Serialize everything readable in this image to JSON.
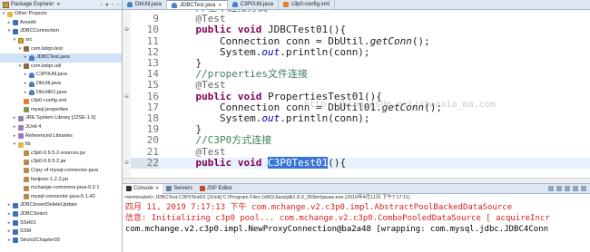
{
  "explorer": {
    "title": "Package Explorer",
    "close": "✕",
    "tools": "▫ ▾ ▫ ▫",
    "items": [
      {
        "twisty": "▾",
        "icon": "folder-icon",
        "label": "Other Projects",
        "indent": 0
      },
      {
        "twisty": "▸",
        "icon": "project-icon",
        "label": "Annoth",
        "indent": 1
      },
      {
        "twisty": "▾",
        "icon": "project-icon",
        "label": "JDBCConnection",
        "indent": 1
      },
      {
        "twisty": "▾",
        "icon": "source-folder-icon",
        "label": "src",
        "indent": 2
      },
      {
        "twisty": "▾",
        "icon": "package-icon",
        "label": "com.bdqn.test",
        "indent": 3
      },
      {
        "twisty": "▸",
        "icon": "java-file-icon",
        "label": "JDBCTest.java",
        "indent": 4,
        "selected": true
      },
      {
        "twisty": "▾",
        "icon": "package-icon",
        "label": "com.bdqn.util",
        "indent": 3
      },
      {
        "twisty": "▸",
        "icon": "java-file-icon",
        "label": "C3P0Util.java",
        "indent": 4
      },
      {
        "twisty": "▸",
        "icon": "java-file-icon",
        "label": "DbUtil.java",
        "indent": 4
      },
      {
        "twisty": "▸",
        "icon": "java-file-icon",
        "label": "DbUtil01.java",
        "indent": 4
      },
      {
        "twisty": "",
        "icon": "xml-file-icon",
        "label": "c3p0-config.xml",
        "indent": 3
      },
      {
        "twisty": "",
        "icon": "properties-file-icon",
        "label": "mysql.properties",
        "indent": 3
      },
      {
        "twisty": "▸",
        "icon": "library-icon",
        "label": "JRE System Library [J2SE-1.5]",
        "indent": 2
      },
      {
        "twisty": "▸",
        "icon": "library-icon",
        "label": "JUnit 4",
        "indent": 2
      },
      {
        "twisty": "▸",
        "icon": "library-icon",
        "label": "Referenced Libraries",
        "indent": 2
      },
      {
        "twisty": "▾",
        "icon": "folder-icon",
        "label": "lib",
        "indent": 2
      },
      {
        "twisty": "",
        "icon": "jar-icon",
        "label": "c3p0-0.9.5.2-sources.jar",
        "indent": 3
      },
      {
        "twisty": "",
        "icon": "jar-icon",
        "label": "c3p0-0.9.5.2.jar",
        "indent": 3
      },
      {
        "twisty": "",
        "icon": "jar-icon",
        "label": "Copy of mysql-connector-java",
        "indent": 3
      },
      {
        "twisty": "",
        "icon": "jar-icon",
        "label": "fastjson-1.2.2.jar",
        "indent": 3
      },
      {
        "twisty": "",
        "icon": "jar-icon",
        "label": "mchange-commons-java-0.2.1",
        "indent": 3
      },
      {
        "twisty": "",
        "icon": "jar-icon",
        "label": "mysql-connector-java-5.1.42-",
        "indent": 3
      },
      {
        "twisty": "▸",
        "icon": "project-icon",
        "label": "JDBCInsertDeleteUpdate",
        "indent": 1
      },
      {
        "twisty": "▸",
        "icon": "project-icon",
        "label": "JDBCSelect",
        "indent": 1
      },
      {
        "twisty": "▸",
        "icon": "project-icon",
        "label": "SSH01",
        "indent": 1
      },
      {
        "twisty": "▸",
        "icon": "project-icon",
        "label": "SSM",
        "indent": 1
      },
      {
        "twisty": "▸",
        "icon": "project-icon",
        "label": "Struts2Chapter03",
        "indent": 1
      }
    ]
  },
  "editor": {
    "tabs": [
      {
        "label": "DbUtil.java",
        "type": "java",
        "active": false
      },
      {
        "label": "JDBCTest.java",
        "type": "java",
        "active": true
      },
      {
        "label": "C3P0Util.java",
        "type": "java",
        "active": false
      },
      {
        "label": "c3p0-config.xml",
        "type": "xml",
        "active": false
      }
    ],
    "close": "✕",
    "watermark": "http://blog.csdn.net/zhaoxia_ma.com",
    "lines": [
      {
        "num": "",
        "indent": "    ",
        "parts": [
          {
            "c": "comment",
            "t": "//基本连接方式"
          }
        ]
      },
      {
        "num": "9",
        "indent": "    ",
        "parts": [
          {
            "c": "annotation",
            "t": "@Test"
          }
        ]
      },
      {
        "num": "10",
        "indent": "    ",
        "parts": [
          {
            "c": "keyword",
            "t": "public"
          },
          {
            "c": "",
            "t": " "
          },
          {
            "c": "keyword",
            "t": "void"
          },
          {
            "c": "",
            "t": " JDBCTest01(){"
          }
        ]
      },
      {
        "num": "11",
        "indent": "        ",
        "parts": [
          {
            "c": "",
            "t": "Connection conn = DbUtil."
          },
          {
            "c": "method",
            "t": "getConn"
          },
          {
            "c": "",
            "t": "();"
          }
        ]
      },
      {
        "num": "12",
        "indent": "        ",
        "parts": [
          {
            "c": "",
            "t": "System."
          },
          {
            "c": "field",
            "t": "out"
          },
          {
            "c": "",
            "t": ".println(conn);"
          }
        ]
      },
      {
        "num": "13",
        "indent": "    ",
        "parts": [
          {
            "c": "",
            "t": "}"
          }
        ]
      },
      {
        "num": "14",
        "indent": "    ",
        "parts": [
          {
            "c": "comment",
            "t": "//properties文件连接"
          }
        ]
      },
      {
        "num": "15",
        "indent": "    ",
        "parts": [
          {
            "c": "annotation",
            "t": "@Test"
          }
        ]
      },
      {
        "num": "16",
        "indent": "    ",
        "parts": [
          {
            "c": "keyword",
            "t": "public"
          },
          {
            "c": "",
            "t": " "
          },
          {
            "c": "keyword",
            "t": "void"
          },
          {
            "c": "",
            "t": " PropertiesTest01(){"
          }
        ]
      },
      {
        "num": "17",
        "indent": "        ",
        "parts": [
          {
            "c": "",
            "t": "Connection conn = DbUtil01."
          },
          {
            "c": "method",
            "t": "getConn"
          },
          {
            "c": "",
            "t": "();"
          }
        ]
      },
      {
        "num": "18",
        "indent": "        ",
        "parts": [
          {
            "c": "",
            "t": "System."
          },
          {
            "c": "field",
            "t": "out"
          },
          {
            "c": "",
            "t": ".println(conn);"
          }
        ]
      },
      {
        "num": "19",
        "indent": "    ",
        "parts": [
          {
            "c": "",
            "t": "}"
          }
        ]
      },
      {
        "num": "20",
        "indent": "    ",
        "parts": [
          {
            "c": "comment",
            "t": "//C3P0方式连接"
          }
        ]
      },
      {
        "num": "21",
        "indent": "    ",
        "parts": [
          {
            "c": "annotation",
            "t": "@Test"
          }
        ]
      },
      {
        "num": "22",
        "indent": "    ",
        "parts": [
          {
            "c": "keyword",
            "t": "public"
          },
          {
            "c": "",
            "t": " "
          },
          {
            "c": "keyword",
            "t": "void"
          },
          {
            "c": "",
            "t": " "
          },
          {
            "c": "sel",
            "t": "C3P0Test01"
          },
          {
            "c": "",
            "t": "(){"
          }
        ]
      }
    ]
  },
  "console": {
    "tabs": [
      {
        "label": "Console",
        "icon": "console-icon",
        "active": true,
        "close": "✕"
      },
      {
        "label": "Servers",
        "icon": "servers-icon",
        "active": false,
        "close": ""
      },
      {
        "label": "JSP Editor",
        "icon": "jsp-icon",
        "active": false,
        "close": ""
      }
    ],
    "header": "<terminated> JDBCTest.C3P0Test01 [JUnit] C:\\Program Files (x86)\\Java\\jdk1.8.0_05\\bin\\javaw.exe (2019年4月11日 下午7:17:11)",
    "lines": [
      {
        "kind": "err",
        "text": "四月 11, 2019 7:17:13 下午 com.mchange.v2.c3p0.impl.AbstractPoolBackedDataSource"
      },
      {
        "kind": "err",
        "text": "信息: Initializing c3p0 pool... com.mchange.v2.c3p0.ComboPooledDataSource [ acquireIncr"
      },
      {
        "kind": "out",
        "text": "com.mchange.v2.c3p0.impl.NewProxyConnection@ba2a48 [wrapping: com.mysql.jdbc.JDBC4Conn"
      }
    ]
  }
}
